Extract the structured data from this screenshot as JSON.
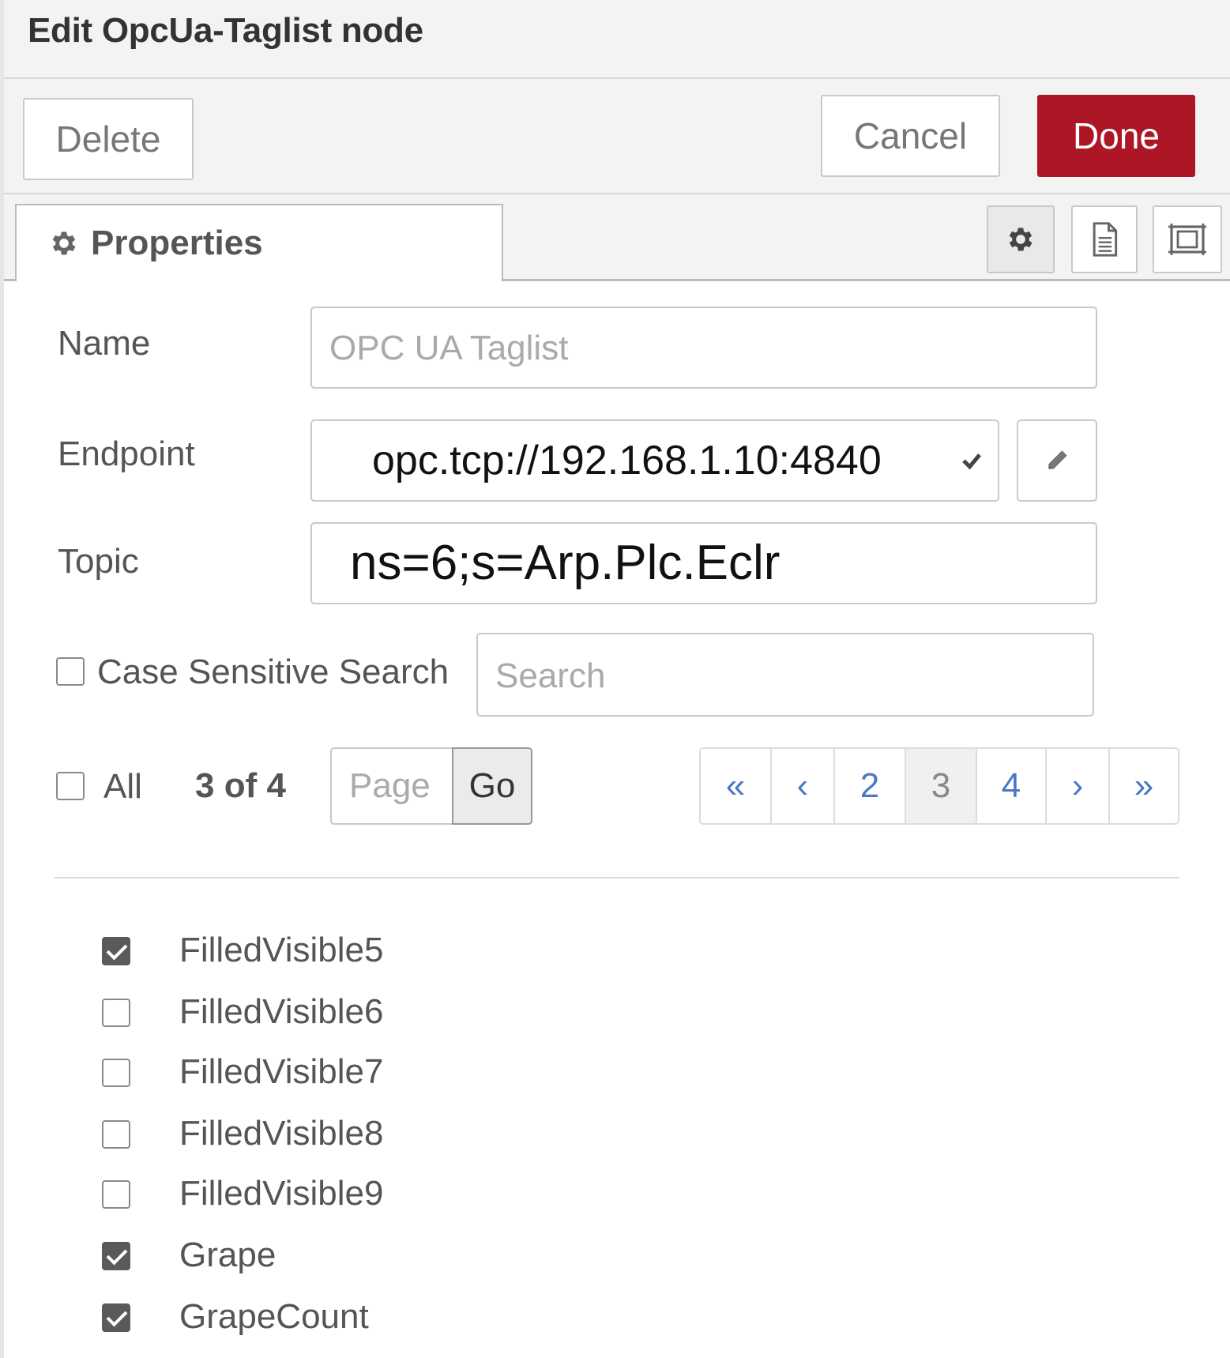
{
  "dialog": {
    "title": "Edit OpcUa-Taglist node"
  },
  "toolbar": {
    "delete_label": "Delete",
    "cancel_label": "Cancel",
    "done_label": "Done",
    "done_color": "#ad1625"
  },
  "tabs": {
    "properties_label": "Properties",
    "icons": [
      "gear-icon",
      "document-icon",
      "frame-icon"
    ]
  },
  "form": {
    "name_label": "Name",
    "name_placeholder": "OPC UA Taglist",
    "endpoint_label": "Endpoint",
    "endpoint_value": "opc.tcp://192.168.1.10:4840",
    "topic_label": "Topic",
    "topic_value": "ns=6;s=Arp.Plc.Eclr",
    "case_sensitive_label": "Case Sensitive Search",
    "case_sensitive_checked": false,
    "search_placeholder": "Search"
  },
  "pagination": {
    "all_label": "All",
    "all_checked": false,
    "page_info": "3 of 4",
    "page_placeholder": "Page",
    "go_label": "Go",
    "controls": [
      {
        "label": "«",
        "active": false
      },
      {
        "label": "‹",
        "active": false
      },
      {
        "label": "2",
        "active": false
      },
      {
        "label": "3",
        "active": true
      },
      {
        "label": "4",
        "active": false
      },
      {
        "label": "›",
        "active": false
      },
      {
        "label": "»",
        "active": false
      }
    ]
  },
  "tags": [
    {
      "label": "FilledVisible5",
      "checked": true
    },
    {
      "label": "FilledVisible6",
      "checked": false
    },
    {
      "label": "FilledVisible7",
      "checked": false
    },
    {
      "label": "FilledVisible8",
      "checked": false
    },
    {
      "label": "FilledVisible9",
      "checked": false
    },
    {
      "label": "Grape",
      "checked": true
    },
    {
      "label": "GrapeCount",
      "checked": true
    }
  ]
}
